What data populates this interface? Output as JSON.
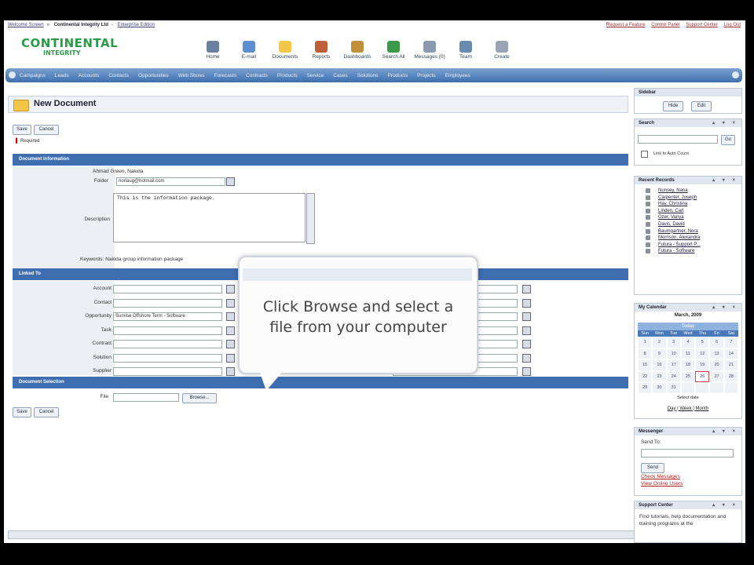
{
  "header": {
    "breadcrumb": [
      "Welcome Screen",
      "Continental Integrity Ltd",
      "Enterprise Edition"
    ],
    "right_links": [
      "Request a Feature",
      "Control Panel",
      "Support Center",
      "Log Out"
    ],
    "logo_line1": "CONTINENTAL",
    "logo_line2": "INTEGRITY"
  },
  "toolbar": [
    {
      "label": "Home",
      "icon": "home-icon",
      "color": "#6b7fa0"
    },
    {
      "label": "E-mail",
      "icon": "email-icon",
      "color": "#5c8fd0"
    },
    {
      "label": "Documents",
      "icon": "documents-icon",
      "color": "#f2c648"
    },
    {
      "label": "Reports",
      "icon": "reports-icon",
      "color": "#c0603a"
    },
    {
      "label": "Dashboards",
      "icon": "dashboards-icon",
      "color": "#c0903a"
    },
    {
      "label": "Search All",
      "icon": "search-all-icon",
      "color": "#3a9a4a"
    },
    {
      "label": "Messages (0)",
      "icon": "messages-icon",
      "color": "#8a98b0"
    },
    {
      "label": "Team",
      "icon": "team-icon",
      "color": "#6a8ab0"
    },
    {
      "label": "Create",
      "icon": "create-icon",
      "color": "#9aa4b4"
    }
  ],
  "modules": [
    "Campaigns",
    "Leads",
    "Accounts",
    "Contacts",
    "Opportunities",
    "Web Stores",
    "Forecasts",
    "Contracts",
    "Products",
    "Service",
    "Cases",
    "Solutions",
    "Products",
    "Projects",
    "Employees"
  ],
  "page": {
    "title": "New Document",
    "save_label": "Save",
    "cancel_label": "Cancel",
    "required_label": "Required"
  },
  "document_info": {
    "section_title": "Document Information",
    "owner_value": "Ahmad Green, Nakida",
    "folder_label": "Folder",
    "folder_value": "norlaug@hotmail.com",
    "description_label": "Description",
    "description_value": "This is the information package.",
    "keywords_label": "Keywords",
    "keywords_value": "Nakida group information package"
  },
  "linked_to": {
    "section_title": "Linked To",
    "fields": [
      {
        "label": "Account",
        "value": ""
      },
      {
        "label": "Contact",
        "value": ""
      },
      {
        "label": "Opportunity",
        "value": "Sunrise Offshore Term - Software"
      },
      {
        "label": "Task",
        "value": ""
      },
      {
        "label": "Contract",
        "value": ""
      },
      {
        "label": "Solution",
        "value": ""
      },
      {
        "label": "Supplier",
        "value": ""
      }
    ]
  },
  "doc_selection": {
    "section_title": "Document Selection",
    "file_label": "File",
    "browse_label": "Browse..."
  },
  "callout": {
    "line1": "Click Browse and select a",
    "line2": "file from your computer"
  },
  "sidebar": {
    "sidebar_title": "Sidebar",
    "hide_label": "Hide",
    "edit_label": "Edit",
    "search_title": "Search",
    "search_go": "Go",
    "search_check": "Link to Auto Count",
    "recent_title": "Recent Records",
    "recent": [
      "Nunsey, Nana",
      "Carpenter, Joseph",
      "Hay, Christina",
      "Linden, Carl",
      "Ozer, Vanya",
      "Davis, David",
      "Baumgartner, Nora",
      "Morrison, Alexandra",
      "Futura - Support P...",
      "Futura - Software"
    ],
    "calendar_title": "My Calendar",
    "calendar_month": "March, 2009",
    "calendar_today": "Today",
    "calendar_days": [
      "Sun",
      "Mon",
      "Tue",
      "Wed",
      "Thu",
      "Fri",
      "Sat"
    ],
    "calendar_dates": [
      "1",
      "2",
      "3",
      "4",
      "5",
      "6",
      "7",
      "8",
      "9",
      "10",
      "11",
      "12",
      "13",
      "14",
      "15",
      "16",
      "17",
      "18",
      "19",
      "20",
      "21",
      "22",
      "23",
      "24",
      "25",
      "26",
      "27",
      "28",
      "29",
      "30",
      "31",
      "",
      "",
      "",
      ""
    ],
    "calendar_select": "Select date",
    "calendar_views": "Day | Week | Month",
    "messenger_title": "Messenger",
    "messenger_send_to": "Send To:",
    "messenger_send": "Send",
    "messenger_links": [
      "Check Messages",
      "View Online Users"
    ],
    "support_title": "Support Center",
    "support_text": "Find tutorials, help documentation and training programs at the"
  }
}
